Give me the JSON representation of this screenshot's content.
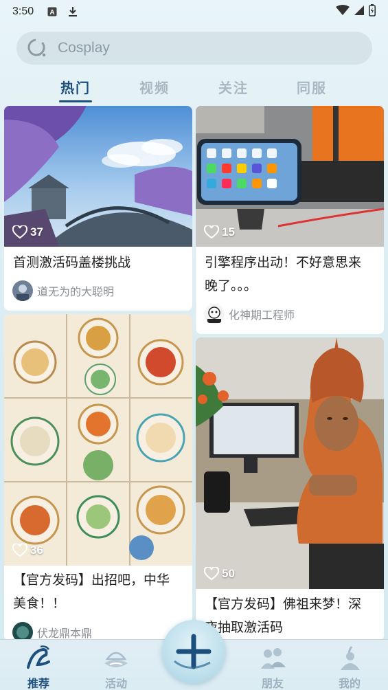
{
  "status": {
    "time": "3:50"
  },
  "search": {
    "placeholder": "Cosplay"
  },
  "tabs": [
    {
      "label": "热门",
      "active": true
    },
    {
      "label": "视频"
    },
    {
      "label": "关注"
    },
    {
      "label": "同服"
    }
  ],
  "posts": [
    {
      "likes": "37",
      "title": "首测激活码盖楼挑战",
      "author": "道无为的大聪明"
    },
    {
      "likes": "15",
      "title_line1": "引擎程序出动！不好意思来",
      "title_line2": "晚了。。。",
      "author": "化神期工程师"
    },
    {
      "likes": "36",
      "title_line1": "【官方发码】出招吧，中华",
      "title_line2": "美食！！",
      "author": "伏龙鼎本鼎"
    },
    {
      "likes": "50",
      "title_line1": "【官方发码】佛祖来梦！深",
      "title_line2": "夜抽取激活码"
    }
  ],
  "nav": [
    {
      "label": "推荐",
      "active": true
    },
    {
      "label": "活动"
    },
    {
      "label": "朋友"
    },
    {
      "label": "我的"
    }
  ],
  "colors": {
    "accent": "#1d4f7e",
    "inactive": "#a8b7c0"
  }
}
